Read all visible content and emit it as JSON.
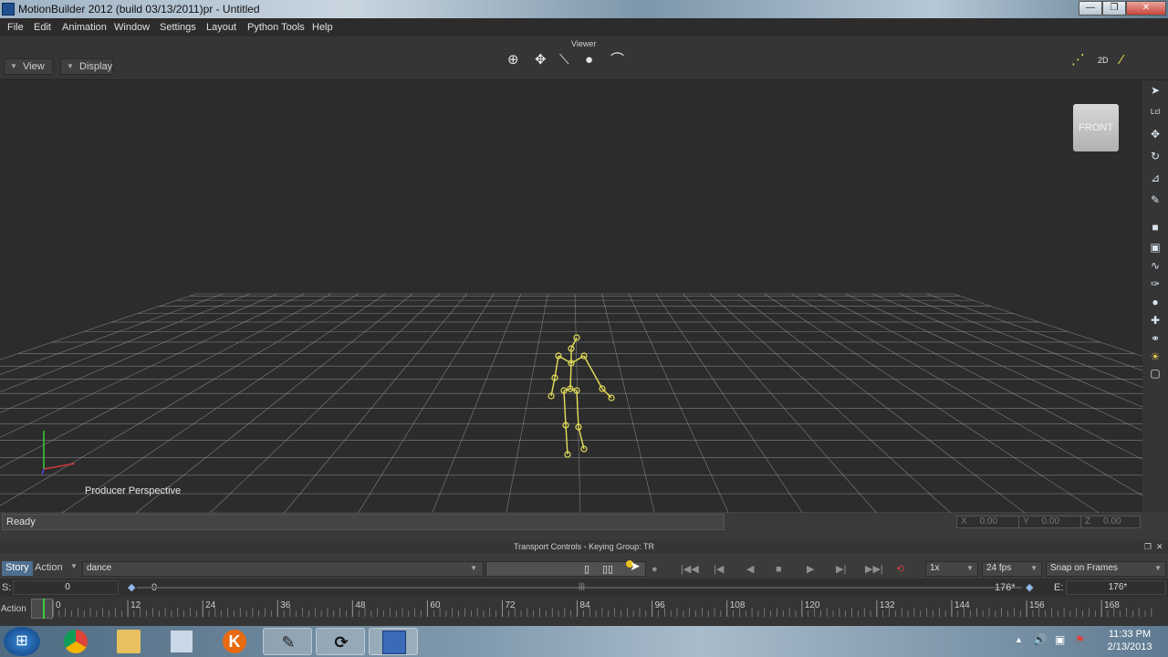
{
  "window": {
    "title": "MotionBuilder 2012  (build 03/13/2011)pr  - Untitled",
    "minimize_glyph": "—",
    "restore_glyph": "❐",
    "close_glyph": "✕"
  },
  "menu": [
    "File",
    "Edit",
    "Animation",
    "Window",
    "Settings",
    "Layout",
    "Python Tools",
    "Help"
  ],
  "viewer": {
    "label": "Viewer",
    "view_button": "View",
    "display_button": "Display",
    "nav_cube_label": "FRONT",
    "camera_label": "Producer Perspective",
    "mode_2d": "2D",
    "right_toolbar": {
      "lcl": "Lcl"
    }
  },
  "status": {
    "text": "Ready",
    "x_label": "X",
    "x_value": "0.00",
    "y_label": "Y",
    "y_value": "0.00",
    "z_label": "Z",
    "z_value": "0.00"
  },
  "transport": {
    "title": "Transport Controls  -  Keying Group: TR",
    "tab_story": "Story",
    "tab_action": "Action",
    "take": "dance",
    "speed": "1x",
    "fps": "24 fps",
    "snap": "Snap on Frames"
  },
  "range": {
    "start_label": "S:",
    "start_value": "0",
    "current_start": "0",
    "end_marker": "176*",
    "end_label": "E:",
    "end_value": "176*"
  },
  "ruler": {
    "track_label": "Action",
    "ticks": [
      "0",
      "12",
      "24",
      "36",
      "48",
      "60",
      "72",
      "84",
      "96",
      "108",
      "120",
      "132",
      "144",
      "156",
      "168"
    ]
  },
  "taskbar": {
    "start_glyph": "⊞",
    "apps": [
      "Chrome",
      "Explorer",
      "Calculator",
      "K",
      "Inkscape",
      "MotionBuilder",
      "Media"
    ],
    "app_k_glyph": "K",
    "tray": {
      "time": "11:33 PM",
      "date": "2/13/2013"
    }
  },
  "colors": {
    "viewport_bg": "#2c2c2c",
    "grid": "#9a9a9a",
    "skeleton": "#e8e05a",
    "axis_x": "#d23a3a",
    "axis_y": "#3ad23a",
    "axis_z": "#4a4ad8"
  }
}
